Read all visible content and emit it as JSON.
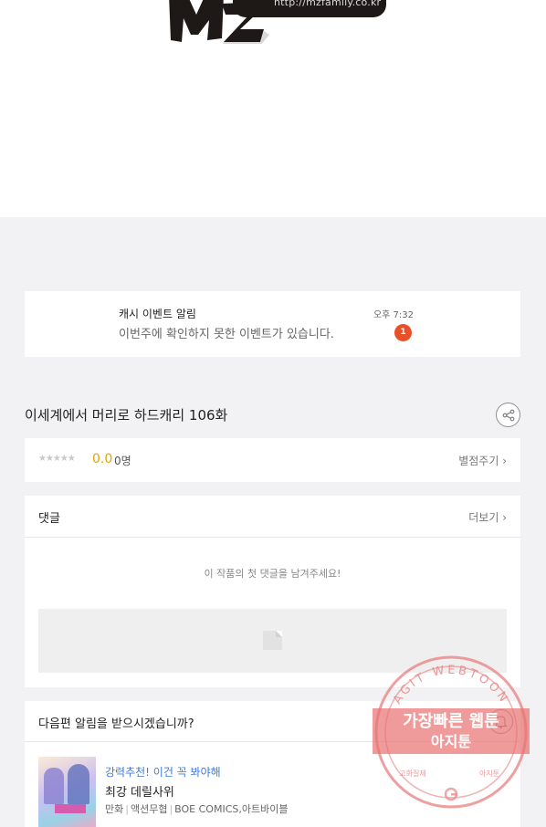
{
  "banner": {
    "url": "http://mzfamily.co.kr"
  },
  "notice": {
    "title": "캐시 이벤트 알림",
    "message": "이번주에 확인하지 못한 이벤트가 있습니다.",
    "time": "오후 7:32",
    "badge": "1",
    "badge_color": "#e85029"
  },
  "episode": {
    "title": "이세계에서 머리로 하드캐리 106화",
    "share_icon": "share-icon"
  },
  "rating": {
    "stars": "★★★★★",
    "score": "0.0",
    "count": "0명",
    "rate_label": "별점주기 ›",
    "score_color": "#e2a500"
  },
  "comments": {
    "title": "댓글",
    "more_label": "더보기 ›",
    "empty_message": "이 작품의 첫 댓글을 남겨주세요!"
  },
  "alarm": {
    "title": "다음편 알림을 받으시겠습니까?",
    "bell_icon": "bell-icon",
    "recommend": {
      "tagline": "강력추천! 이건 꼭 봐야해",
      "title": "최강 데릴사위",
      "category": "만화",
      "genre": "액션무협",
      "publisher": "BOE COMICS,아트바이블",
      "accent_color": "#3d7be0"
    }
  },
  "watermark": {
    "top_text": "AGIT WEBTOON",
    "headline": "가장빠른 웹툰",
    "name": "아지툰",
    "bottom_left": "고화질제",
    "bottom_right": "아지툰",
    "color": "#e88080"
  }
}
